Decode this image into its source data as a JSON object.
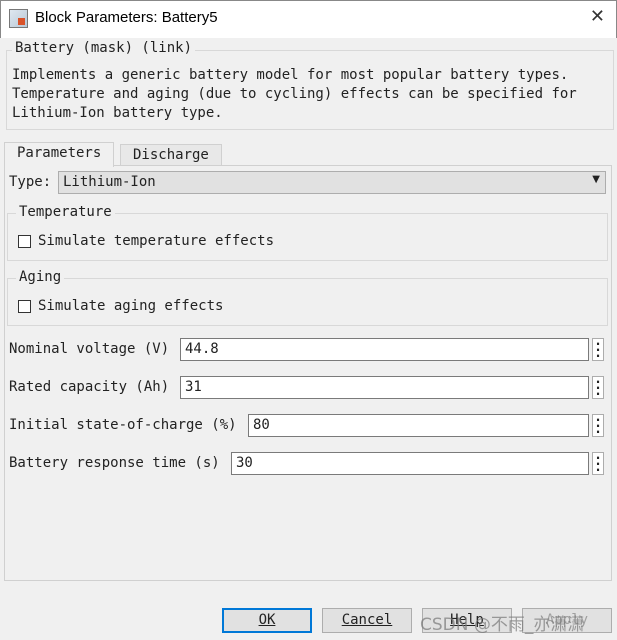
{
  "window": {
    "title": "Block Parameters: Battery5",
    "close_icon": "close-icon"
  },
  "mask": {
    "title": "Battery (mask) (link)",
    "description": [
      "Implements a generic battery model for most popular battery types.",
      "Temperature and aging (due to cycling) effects can be specified for",
      "Lithium-Ion battery type."
    ]
  },
  "tabs": [
    {
      "label": "Parameters",
      "active": true
    },
    {
      "label": "Discharge",
      "active": false
    }
  ],
  "type": {
    "label": "Type:",
    "value": "Lithium-Ion"
  },
  "temperature": {
    "title": "Temperature",
    "checkbox_label": "Simulate temperature effects",
    "checked": false
  },
  "aging": {
    "title": "Aging",
    "checkbox_label": "Simulate aging effects",
    "checked": false
  },
  "fields": [
    {
      "label": "Nominal voltage (V)",
      "value": "44.8"
    },
    {
      "label": "Rated capacity (Ah)",
      "value": "31"
    },
    {
      "label": "Initial state-of-charge (%)",
      "value": "80"
    },
    {
      "label": "Battery response time (s)",
      "value": "30"
    }
  ],
  "buttons": {
    "ok": "OK",
    "cancel": "Cancel",
    "help": "Help",
    "apply": "Apply"
  },
  "watermark": "CSDN @不雨_亦潇潇"
}
